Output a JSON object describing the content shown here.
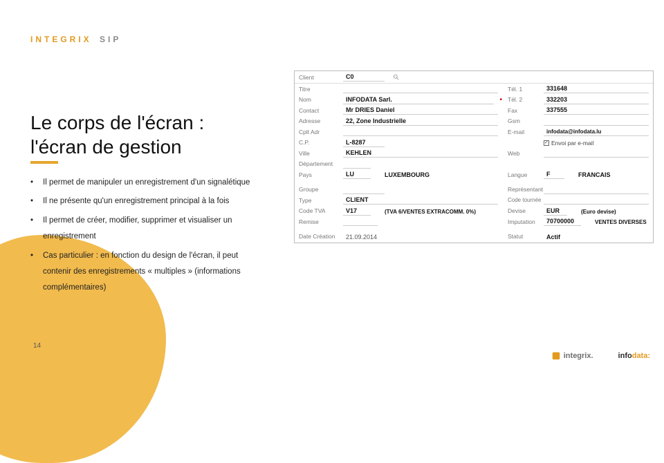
{
  "header": {
    "brand1": "INTEGRIX",
    "brand2": "SIP"
  },
  "title": {
    "line1": "Le corps de l'écran :",
    "line2": "l'écran de gestion"
  },
  "bullets": {
    "b1": "Il permet de manipuler un enregistrement d'un signalétique",
    "b2": "Il ne présente qu'un enregistrement principal à la fois",
    "b3a": "Il permet de créer, modifier, supprimer et visualiser un",
    "b3b": "enregistrement",
    "b4a": "Cas particulier : en fonction du design de l'écran, il peut",
    "b4b": "contenir des enregistrements « multiples » (informations",
    "b4c": "complémentaires)"
  },
  "page_number": "14",
  "footer": {
    "brand1": "integrix.",
    "brand2a": "info",
    "brand2b": "data:"
  },
  "form": {
    "client_lbl": "Client",
    "client_val": "C0",
    "titre_lbl": "Titre",
    "nom_lbl": "Nom",
    "nom_val": "INFODATA Sarl.",
    "contact_lbl": "Contact",
    "contact_val": "Mr DRIES Daniel",
    "adresse_lbl": "Adresse",
    "adresse_val": "22, Zone Industrielle",
    "cplt_lbl": "Cplt Adr",
    "cp_lbl": "C.P.",
    "cp_val": "L-8287",
    "ville_lbl": "Ville",
    "ville_val": "KEHLEN",
    "dept_lbl": "Département",
    "pays_lbl": "Pays",
    "pays_code": "LU",
    "pays_name": "LUXEMBOURG",
    "groupe_lbl": "Groupe",
    "type_lbl": "Type",
    "type_val": "CLIENT",
    "codetva_lbl": "Code TVA",
    "codetva_code": "V17",
    "codetva_name": "(TVA 6/VENTES EXTRACOMM. 0%)",
    "remise_lbl": "Remise",
    "date_lbl": "Date Création",
    "date_val": "21.09.2014",
    "tel1_lbl": "Tél. 1",
    "tel1_val": "331648",
    "tel2_lbl": "Tél. 2",
    "tel2_val": "332203",
    "fax_lbl": "Fax",
    "fax_val": "337555",
    "gsm_lbl": "Gsm",
    "email_lbl": "E-mail",
    "email_val": "infodata@infodata.lu",
    "envoi_lbl": "Envoi par e-mail",
    "web_lbl": "Web",
    "langue_lbl": "Langue",
    "langue_code": "F",
    "langue_name": "FRANCAIS",
    "rep_lbl": "Représentant",
    "tournee_lbl": "Code tournée",
    "devise_lbl": "Devise",
    "devise_code": "EUR",
    "devise_name": "(Euro devise)",
    "imput_lbl": "Imputation",
    "imput_code": "70700000",
    "imput_name": "VENTES DIVERSES",
    "statut_lbl": "Statut",
    "statut_val": "Actif"
  }
}
